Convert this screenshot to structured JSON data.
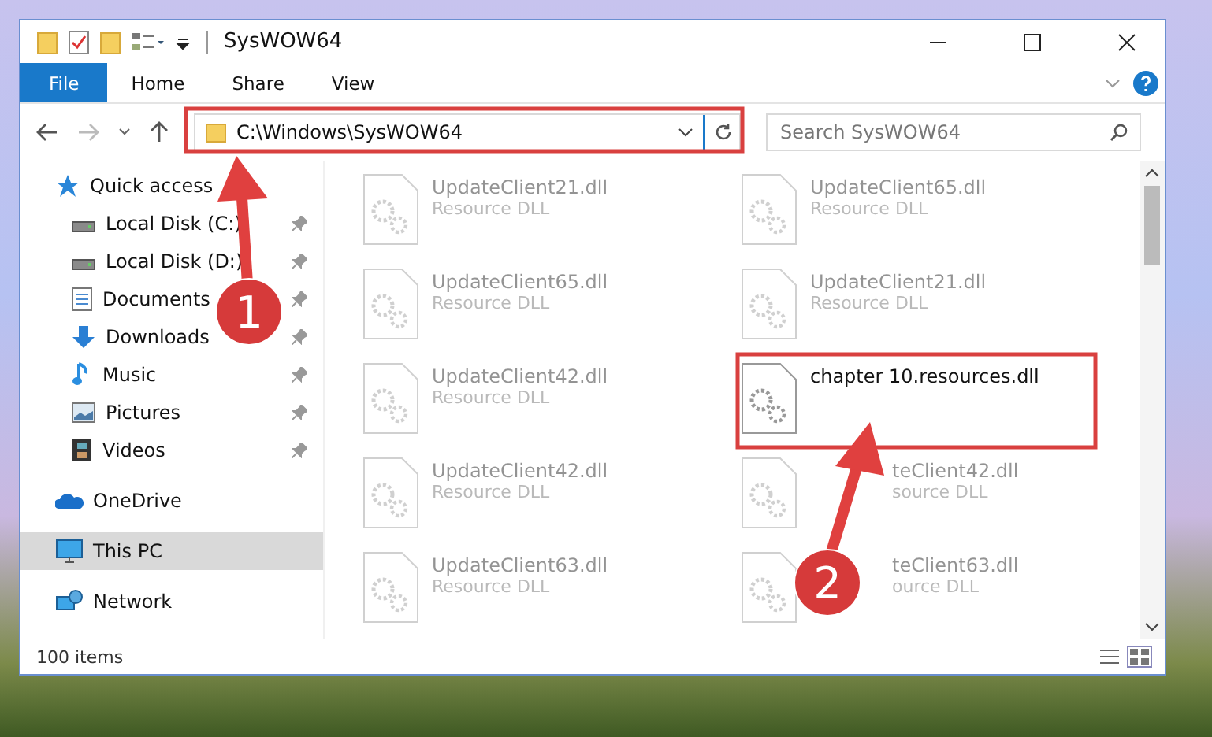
{
  "window": {
    "title": "SysWOW64"
  },
  "ribbon_tabs": [
    {
      "label": "File",
      "selected": true
    },
    {
      "label": "Home",
      "selected": false
    },
    {
      "label": "Share",
      "selected": false
    },
    {
      "label": "View",
      "selected": false
    }
  ],
  "address": "C:\\Windows\\SysWOW64",
  "search": {
    "placeholder": "Search SysWOW64"
  },
  "sidebar": {
    "items": [
      {
        "label": "Quick access",
        "kind": "star",
        "selected": false,
        "children": [
          {
            "label": "Local Disk (C:)",
            "kind": "drive",
            "pinned": true
          },
          {
            "label": "Local Disk (D:)",
            "kind": "drive",
            "pinned": true
          },
          {
            "label": "Documents",
            "kind": "documents",
            "pinned": true
          },
          {
            "label": "Downloads",
            "kind": "downloads",
            "pinned": true
          },
          {
            "label": "Music",
            "kind": "music",
            "pinned": true
          },
          {
            "label": "Pictures",
            "kind": "pictures",
            "pinned": true
          },
          {
            "label": "Videos",
            "kind": "videos",
            "pinned": true
          }
        ]
      },
      {
        "label": "OneDrive",
        "kind": "cloud",
        "selected": false
      },
      {
        "label": "This PC",
        "kind": "computer",
        "selected": true
      },
      {
        "label": "Network",
        "kind": "network",
        "selected": false
      }
    ]
  },
  "files": [
    {
      "name": "UpdateClient21.dll",
      "type": "Resource DLL",
      "faded": true
    },
    {
      "name": "UpdateClient65.dll",
      "type": "Resource DLL",
      "faded": true
    },
    {
      "name": "UpdateClient65.dll",
      "type": "Resource DLL",
      "faded": true
    },
    {
      "name": "UpdateClient21.dll",
      "type": "Resource DLL",
      "faded": true
    },
    {
      "name": "UpdateClient42.dll",
      "type": "Resource DLL",
      "faded": true
    },
    {
      "name": "chapter 10.resources.dll",
      "faded": false
    },
    {
      "name": "UpdateClient42.dll",
      "type": "Resource DLL",
      "faded": true
    },
    {
      "name": "teClient42.dll",
      "type": "source DLL",
      "faded": true,
      "covered": true
    },
    {
      "name": "UpdateClient63.dll",
      "type": "Resource DLL",
      "faded": true
    },
    {
      "name": "teClient63.dll",
      "type": "ource DLL",
      "faded": true,
      "covered": true
    }
  ],
  "status_bar": {
    "count": "100 items"
  },
  "annotations": [
    {
      "label": "1"
    },
    {
      "label": "2"
    }
  ]
}
